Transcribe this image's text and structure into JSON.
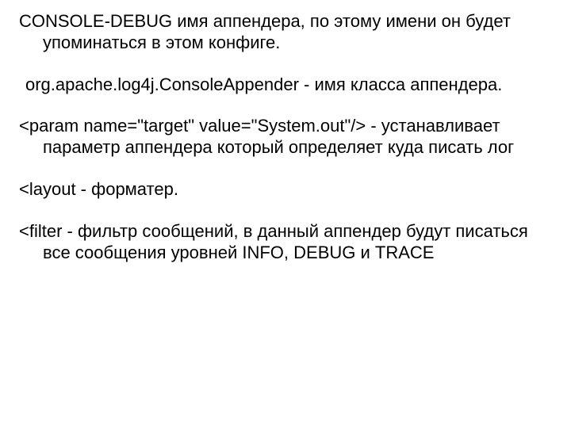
{
  "p1": "CONSOLE-DEBUG имя аппендера, по этому имени он будет  упоминаться в этом конфиге.",
  "p2": "org.apache.log4j.ConsoleAppender - имя класса аппендера.",
  "p3": "<param name=\"target\" value=\"System.out\"/> - устанавливает параметр аппендера который определяет куда писать лог",
  "p4": "<layout - форматер.",
  "p5": "<filter - фильтр сообщений, в данный аппендер будут писаться все сообщения уровней INFO, DEBUG и TRACE"
}
